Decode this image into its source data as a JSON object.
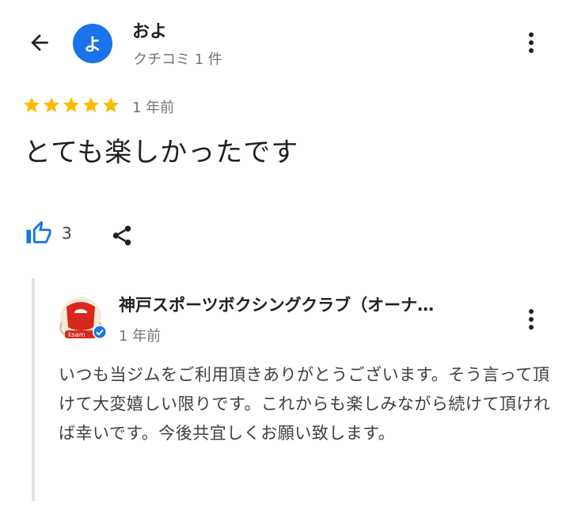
{
  "header": {
    "back_icon": "arrow-back-icon",
    "avatar_letter": "よ",
    "avatar_color": "#1a73e8",
    "reviewer_name": "およ",
    "reviewer_subtitle": "クチコミ 1 件",
    "menu_icon": "more-vert-icon"
  },
  "review": {
    "rating": 5,
    "rating_max": 5,
    "star_color": "#fbbc04",
    "date": "1 年前",
    "text": "とても楽しかったです"
  },
  "actions": {
    "like_icon": "thumb-up-icon",
    "like_color": "#1a73e8",
    "like_count": "3",
    "share_icon": "share-icon"
  },
  "owner_reply": {
    "name": "神戸スポーツボクシングクラブ（オーナ…",
    "date": "1 年前",
    "verified_icon": "verified-badge-icon",
    "menu_icon": "more-vert-icon",
    "text": "いつも当ジムをご利用頂きありがとうございます。そう言って頂けて大変嬉しい限りです。これからも楽しみながら続けて頂ければ幸いです。今後共宜しくお願い致します。"
  }
}
